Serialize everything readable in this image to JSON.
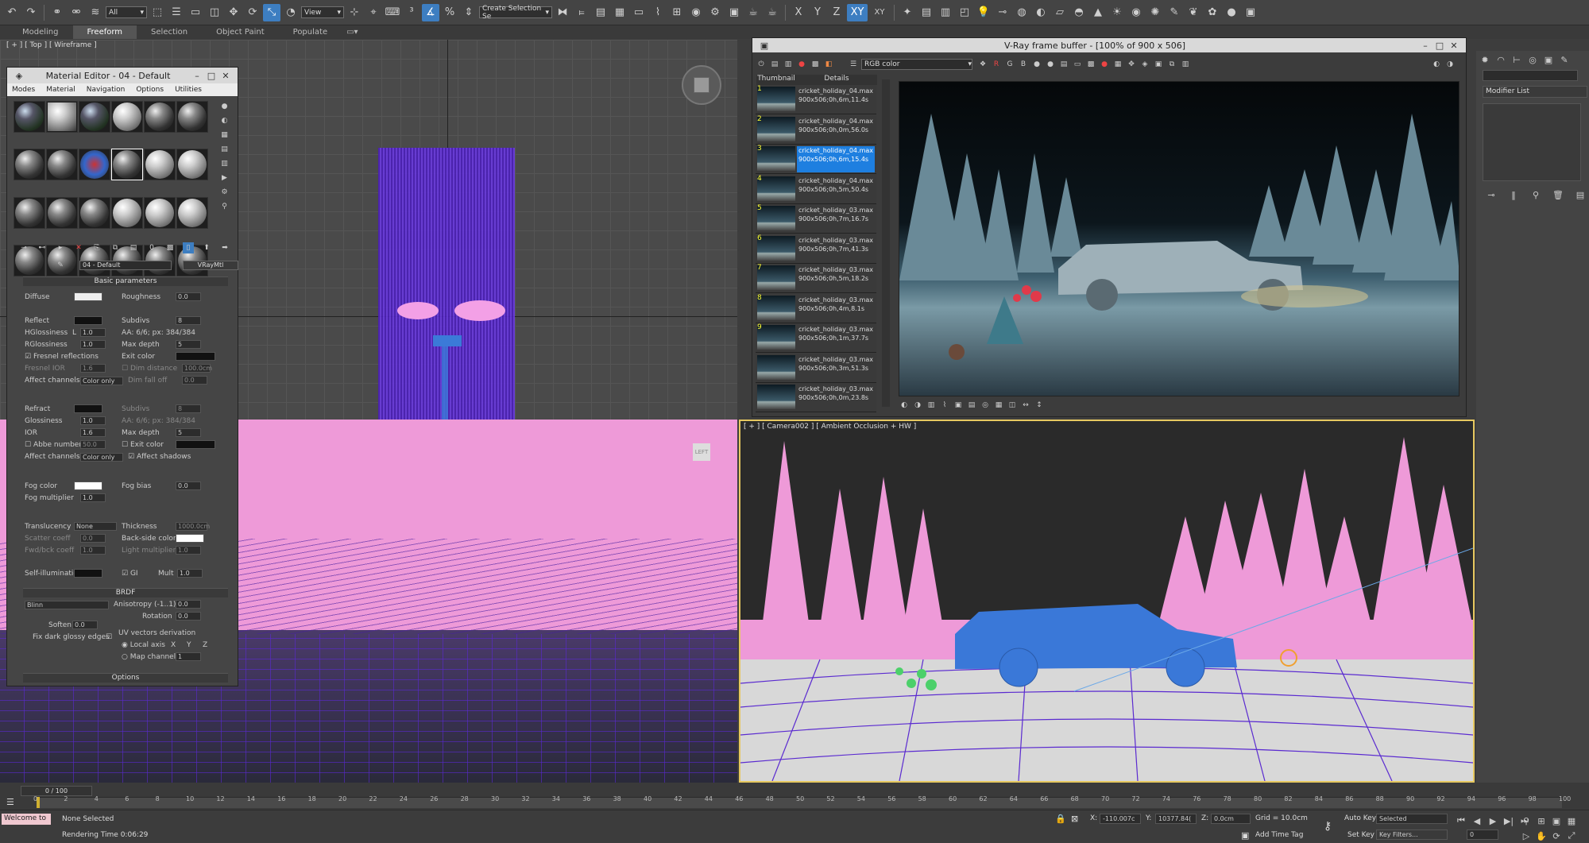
{
  "toolbar": {
    "selection_filter": "All",
    "reference_coord": "View",
    "selection_set": "Create Selection Se",
    "axes": [
      "X",
      "Y",
      "Z",
      "XY",
      "XY"
    ]
  },
  "ribbon": {
    "tabs": [
      "Modeling",
      "Freeform",
      "Selection",
      "Object Paint",
      "Populate"
    ],
    "active": "Freeform"
  },
  "viewports": {
    "top_label": "[ + ] [ Top ] [ Wireframe ]",
    "camera_label": "[ + ] [ Camera002 ] [ Ambient Occlusion + HW ]",
    "left_cube_label": "LEFT"
  },
  "material_editor": {
    "title": "Material Editor - 04 - Default",
    "menu": [
      "Modes",
      "Material",
      "Navigation",
      "Options",
      "Utilities"
    ],
    "material_name": "04 - Default",
    "material_type": "VRayMtl",
    "basic_section": "Basic parameters",
    "rows": {
      "diffuse": "Diffuse",
      "roughness": "Roughness",
      "roughness_val": "0.0",
      "reflect": "Reflect",
      "hglossiness": "HGlossiness",
      "hgloss_val": "1.0",
      "hgloss_lock": "L",
      "subdivs": "Subdivs",
      "subdivs_val": "8",
      "aa": "AA: 6/6; px: 384/384",
      "rglossiness": "RGlossiness",
      "rgloss_val": "1.0",
      "max_depth": "Max depth",
      "max_depth_val": "5",
      "fresnel": "Fresnel reflections",
      "exit_color": "Exit color",
      "fresnel_ior": "Fresnel IOR",
      "fresnel_ior_val": "1.6",
      "dim_distance": "Dim distance",
      "dim_val": "100.0cm",
      "affect_channels": "Affect channels",
      "channels_val": "Color only",
      "dim_falloff": "Dim fall off",
      "dim_falloff_val": "0.0",
      "refract": "Refract",
      "glossiness": "Glossiness",
      "gloss_val": "1.0",
      "r_subdivs": "Subdivs",
      "r_subdivs_val": "8",
      "r_aa": "AA: 6/6; px: 384/384",
      "ior": "IOR",
      "ior_val": "1.6",
      "r_max_depth": "Max depth",
      "r_max_depth_val": "5",
      "abbe": "Abbe number",
      "abbe_val": "50.0",
      "r_exit": "Exit color",
      "r_affect": "Affect channels",
      "r_channels_val": "Color only",
      "affect_shadows": "Affect shadows",
      "fog_color": "Fog color",
      "fog_bias": "Fog bias",
      "fog_bias_val": "0.0",
      "fog_mult": "Fog multiplier",
      "fog_mult_val": "1.0",
      "translucency": "Translucency",
      "trans_val": "None",
      "thickness": "Thickness",
      "thickness_val": "1000.0cm",
      "scatter": "Scatter coeff",
      "scatter_val": "0.0",
      "backside": "Back-side color",
      "fwdbck": "Fwd/bck coeff",
      "fwdbck_val": "1.0",
      "light_mult": "Light multiplier",
      "light_mult_val": "1.0",
      "self_illum": "Self-illumination",
      "gi": "GI",
      "mult": "Mult",
      "mult_val": "1.0",
      "brdf": "BRDF",
      "brdf_type": "Blinn",
      "anisotropy": "Anisotropy (-1..1)",
      "aniso_val": "0.0",
      "rotation": "Rotation",
      "rotation_val": "0.0",
      "soften": "Soften",
      "soften_val": "0.0",
      "uv_deriv": "UV vectors derivation",
      "fix_dark": "Fix dark glossy edges",
      "local_axis": "Local axis",
      "ax_x": "X",
      "ax_y": "Y",
      "ax_z": "Z",
      "map_channel": "Map channel",
      "map_channel_val": "1",
      "options": "Options"
    }
  },
  "vfb": {
    "title": "V-Ray frame buffer - [100% of 900 x 506]",
    "channel": "RGB color",
    "rgb": [
      "R",
      "G",
      "B"
    ],
    "col_thumbnail": "Thumbnail",
    "col_details": "Details",
    "history": [
      {
        "n": "1",
        "file": "cricket_holiday_04.max",
        "info": "900x506;0h,6m,11.4s"
      },
      {
        "n": "2",
        "file": "cricket_holiday_04.max",
        "info": "900x506;0h,0m,56.0s"
      },
      {
        "n": "3",
        "file": "cricket_holiday_04.max",
        "info": "900x506;0h,6m,15.4s"
      },
      {
        "n": "4",
        "file": "cricket_holiday_04.max",
        "info": "900x506;0h,5m,50.4s"
      },
      {
        "n": "5",
        "file": "cricket_holiday_03.max",
        "info": "900x506;0h,7m,16.7s"
      },
      {
        "n": "6",
        "file": "cricket_holiday_03.max",
        "info": "900x506;0h,7m,41.3s"
      },
      {
        "n": "7",
        "file": "cricket_holiday_03.max",
        "info": "900x506;0h,5m,18.2s"
      },
      {
        "n": "8",
        "file": "cricket_holiday_03.max",
        "info": "900x506;0h,4m,8.1s"
      },
      {
        "n": "9",
        "file": "cricket_holiday_03.max",
        "info": "900x506;0h,1m,37.7s"
      },
      {
        "n": "",
        "file": "cricket_holiday_03.max",
        "info": "900x506;0h,3m,51.3s"
      },
      {
        "n": "",
        "file": "cricket_holiday_03.max",
        "info": "900x506;0h,0m,23.8s"
      }
    ],
    "selected_index": 2
  },
  "command_panel": {
    "modifier_list": "Modifier List"
  },
  "timeline": {
    "frame": "0 / 100",
    "ticks": [
      "0",
      "2",
      "4",
      "6",
      "8",
      "10",
      "12",
      "14",
      "16",
      "18",
      "20",
      "22",
      "24",
      "26",
      "28",
      "30",
      "32",
      "34",
      "36",
      "38",
      "40",
      "42",
      "44",
      "46",
      "48",
      "50",
      "52",
      "54",
      "56",
      "58",
      "60",
      "62",
      "64",
      "66",
      "68",
      "70",
      "72",
      "74",
      "76",
      "78",
      "80",
      "82",
      "84",
      "86",
      "88",
      "90",
      "92",
      "94",
      "96",
      "98",
      "100"
    ]
  },
  "status": {
    "welcome": "Welcome to",
    "selection": "None Selected",
    "render_time": "Rendering Time  0:06:29",
    "x_label": "X:",
    "x": "-110.007c",
    "y_label": "Y:",
    "y": "10377.84(",
    "z_label": "Z:",
    "z": "0.0cm",
    "grid": "Grid = 10.0cm",
    "add_time_tag": "Add Time Tag",
    "auto_key": "Auto Key",
    "set_key": "Set Key",
    "key_mode": "Selected",
    "key_filters": "Key Filters...",
    "frame_field": "0"
  },
  "colors": {
    "viewport_pink": "#ee9ad8",
    "wire_purple": "#5a2ad0",
    "car_blue": "#3a78d8",
    "accent": "#1e7fe0"
  }
}
